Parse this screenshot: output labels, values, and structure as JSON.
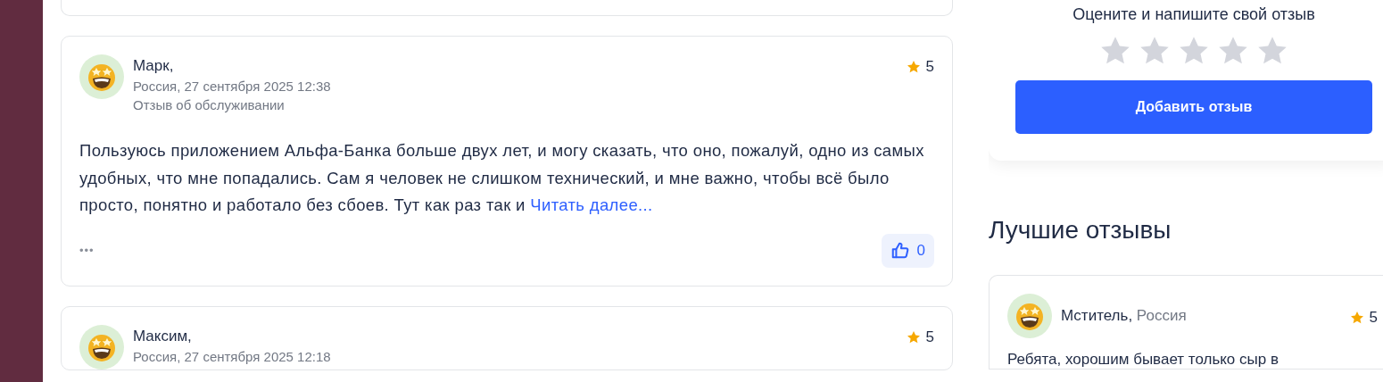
{
  "reviews": [
    {
      "author": "Марк,",
      "meta": "Россия, 27 сентября 2025 12:38",
      "category": "Отзыв об обслуживании",
      "rating": "5",
      "text": "Пользуюсь приложением Альфа-Банка больше двух лет, и могу сказать, что оно, пожалуй, одно из самых удобных, что мне попадались. Сам я человек не слишком технический, и мне важно, чтобы всё было просто, понятно и работало без сбоев. Тут как раз так и",
      "more": "Читать далее...",
      "menu": "•••",
      "likes": "0"
    },
    {
      "author": "Максим,",
      "meta": "Россия, 27 сентября 2025 12:18",
      "rating": "5"
    }
  ],
  "rate_box": {
    "prompt": "Оцените и напишите свой отзыв",
    "stars": 0,
    "button": "Добавить отзыв"
  },
  "best": {
    "title": "Лучшие отзывы",
    "items": [
      {
        "author": "Мститель,",
        "country": "Россия",
        "rating": "5",
        "text": "Ребята, хорошим бывает только сыр в"
      }
    ]
  }
}
